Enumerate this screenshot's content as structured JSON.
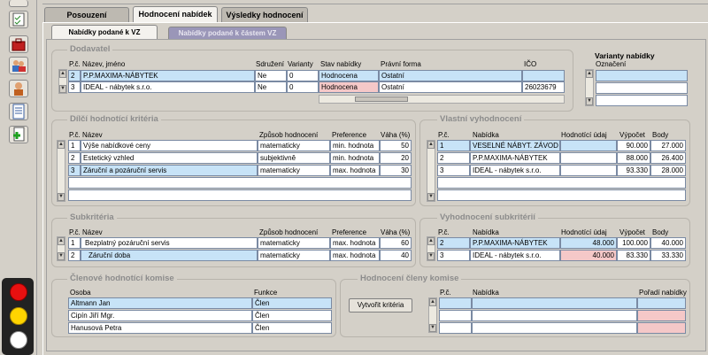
{
  "toolbar": {
    "icons": [
      "window-icon",
      "checklist-icon",
      "toolbox-icon",
      "users-icon",
      "user-icon",
      "document-icon",
      "add-document-icon"
    ]
  },
  "tabs": [
    "Posouzení",
    "Hodnocení nabídek",
    "Výsledky hodnocení"
  ],
  "subtabs": [
    "Nabídky podané k VZ",
    "Nabídky podané k částem VZ"
  ],
  "dodavatel": {
    "title": "Dodavatel",
    "headers": [
      "P.č.",
      "Název, jméno",
      "Sdružení",
      "Varianty",
      "Stav nabídky",
      "Právní forma",
      "IČO"
    ],
    "rows": [
      [
        "2",
        "P.P.MAXIMA-NÁBYTEK",
        "Ne",
        "0",
        "Hodnocena",
        "Ostatní",
        ""
      ],
      [
        "3",
        "IDEAL - nábytek s.r.o.",
        "Ne",
        "0",
        "Hodnocena",
        "Ostatní",
        "26023679"
      ]
    ]
  },
  "varianty": {
    "title": "Varianty nabídky",
    "header": "Označení"
  },
  "dilci": {
    "title": "Dílčí hodnotící kritéria",
    "headers": [
      "P.č.",
      "Název",
      "Způsob hodnocení",
      "Preference",
      "Váha (%)"
    ],
    "rows": [
      [
        "1",
        "Výše nabídkové ceny",
        "matematicky",
        "min. hodnota",
        "50"
      ],
      [
        "2",
        "Estetický vzhled",
        "subjektivně",
        "min. hodnota",
        "20"
      ],
      [
        "3",
        "Záruční a pozáruční servis",
        "matematicky",
        "max. hodnota",
        "30"
      ]
    ]
  },
  "vlastni": {
    "title": "Vlastní vyhodnocení",
    "headers": [
      "P.č.",
      "Nabídka",
      "Hodnotící údaj",
      "Výpočet",
      "Body"
    ],
    "rows": [
      [
        "1",
        "VESELNÉ NÁBYT. ZÁVOD",
        "",
        "90.000",
        "27.000"
      ],
      [
        "2",
        "P.P.MAXIMA-NÁBYTEK",
        "",
        "88.000",
        "26.400"
      ],
      [
        "3",
        "IDEAL - nábytek s.r.o.",
        "",
        "93.330",
        "28.000"
      ]
    ]
  },
  "subkriteria": {
    "title": "Subkritéria",
    "headers": [
      "P.č.",
      "Název",
      "Způsob hodnocení",
      "Preference",
      "Váha (%)"
    ],
    "rows": [
      [
        "1",
        "Bezplatný pozáruční servis",
        "matematicky",
        "max. hodnota",
        "60"
      ],
      [
        "2",
        "Záruční doba",
        "matematicky",
        "max. hodnota",
        "40"
      ]
    ]
  },
  "vyhod_sub": {
    "title": "Vyhodnocení subkritérií",
    "headers": [
      "P.č.",
      "Nabídka",
      "Hodnotící údaj",
      "Výpočet",
      "Body"
    ],
    "rows": [
      [
        "2",
        "P.P.MAXIMA-NÁBYTEK",
        "48.000",
        "100.000",
        "40.000"
      ],
      [
        "3",
        "IDEAL - nábytek s.r.o.",
        "40.000",
        "83.330",
        "33.330"
      ]
    ]
  },
  "clenove": {
    "title": "Členové hodnotící komise",
    "headers": [
      "Osoba",
      "Funkce"
    ],
    "rows": [
      [
        "Altmann Jan",
        "Člen"
      ],
      [
        "Cipín Jiří Mgr.",
        "Člen"
      ],
      [
        "Hanusová Petra",
        "Člen"
      ]
    ]
  },
  "hodnoceni": {
    "title": "Hodnocení členy komise",
    "headers": [
      "P.č.",
      "Nabídka",
      "Pořadí nabídky"
    ],
    "button": "Vytvořit kritéria"
  },
  "colors": {
    "selected": "#c7e3f7",
    "pink": "#f5c8c8",
    "red": "#e81010",
    "yellow": "#ffd400",
    "white": "#ffffff"
  }
}
